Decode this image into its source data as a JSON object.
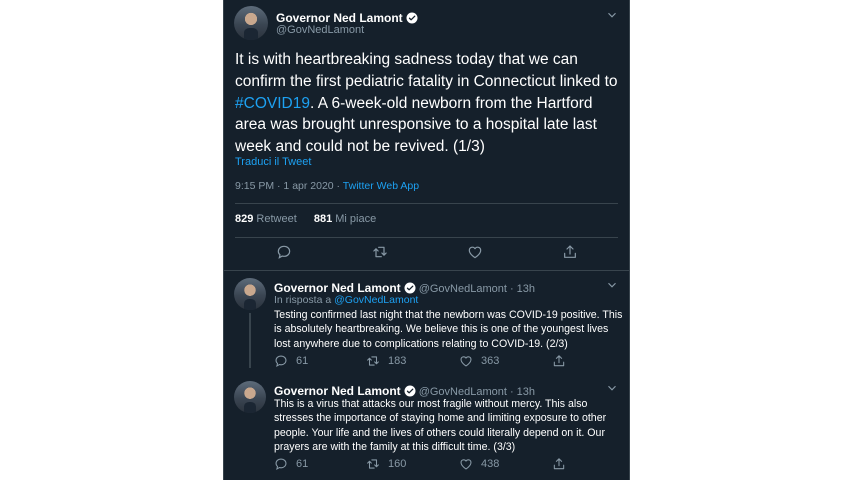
{
  "main_tweet": {
    "name": "Governor Ned Lamont",
    "handle": "@GovNedLamont",
    "text_before": "It is with heartbreaking sadness today that we can confirm the first pediatric fatality in Connecticut linked to ",
    "hashtag": "#COVID19",
    "text_after": ". A 6-week-old newborn from the Hartford area was brought unresponsive to a hospital late last week and could not be revived. (1/3)",
    "translate": "Traduci il Tweet",
    "time": "9:15 PM · 1 apr 2020 · ",
    "source": "Twitter Web App",
    "retweets": "829",
    "retweets_label": " Retweet",
    "likes": "881",
    "likes_label": " Mi piace"
  },
  "replies": [
    {
      "name": "Governor Ned Lamont",
      "handle": "@GovNedLamont · 13h",
      "reply_prefix": "In risposta a ",
      "reply_to": "@GovNedLamont",
      "text": "Testing confirmed last night that the newborn was COVID-19 positive. This is absolutely heartbreaking. We believe this is one of the youngest lives lost anywhere due to complications relating to COVID-19. (2/3)",
      "replies": "61",
      "retweets": "183",
      "likes": "363"
    },
    {
      "name": "Governor Ned Lamont",
      "handle": "@GovNedLamont · 13h",
      "text": "This is a virus that attacks our most fragile without mercy. This also stresses the importance of staying home and limiting exposure to other people. Your life and the lives of others could literally depend on it. Our prayers are with the family at this difficult time. (3/3)",
      "replies": "61",
      "retweets": "160",
      "likes": "438"
    }
  ],
  "icons": [
    "verified-badge-icon",
    "chevron-down-icon",
    "reply-icon",
    "retweet-icon",
    "like-icon",
    "share-icon"
  ],
  "colors": {
    "background": "#15202b",
    "accent": "#1da1f2",
    "muted": "#8899a6",
    "divider": "#38444d"
  }
}
